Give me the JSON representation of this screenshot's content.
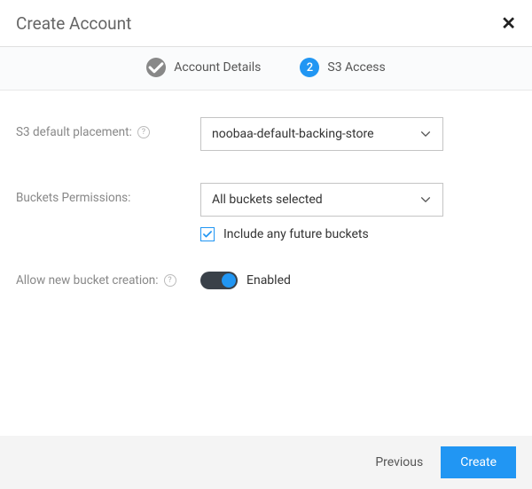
{
  "header": {
    "title": "Create Account",
    "close_glyph": "✕"
  },
  "steps": {
    "step1": {
      "label": "Account Details",
      "icon": "check"
    },
    "step2": {
      "number": "2",
      "label": "S3 Access"
    }
  },
  "form": {
    "placement": {
      "label": "S3 default placement:",
      "value": "noobaa-default-backing-store"
    },
    "buckets": {
      "label": "Buckets Permissions:",
      "value": "All buckets selected",
      "future_label": "Include any future buckets",
      "future_checked": true
    },
    "allow_new": {
      "label": "Allow new bucket creation:",
      "state_label": "Enabled",
      "enabled": true
    },
    "help_glyph": "?"
  },
  "footer": {
    "previous": "Previous",
    "create": "Create"
  }
}
